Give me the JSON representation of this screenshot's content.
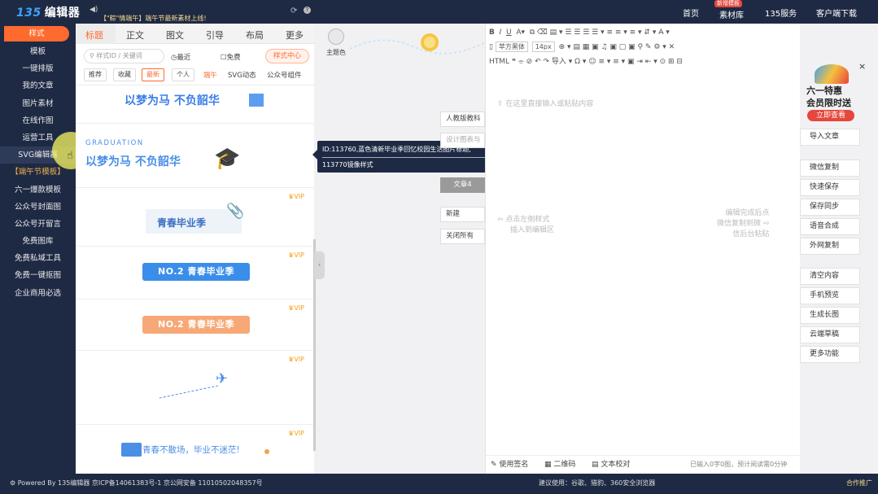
{
  "topbar": {
    "logo_mark": "135",
    "logo_text": "编辑器",
    "notice": "【\"粽\"情端午】端午节最新素材上线!",
    "nav": [
      "首页",
      "素材库",
      "135服务",
      "客户端下载"
    ],
    "badge": "新增模板"
  },
  "sidebar": {
    "items": [
      "样式",
      "模板",
      "一键排版",
      "我的文章",
      "图片素材",
      "在线作图",
      "运营工具",
      "SVG编辑器",
      "【端午节模板】",
      "六一爆款模板",
      "公众号封面图",
      "公众号开留言",
      "免费图库",
      "免费私域工具",
      "免费一键抠图",
      "企业商用必选"
    ],
    "active_index": 0
  },
  "template_panel": {
    "tabs": [
      "标题",
      "正文",
      "图文",
      "引导",
      "布局",
      "更多"
    ],
    "active_tab": 0,
    "search_placeholder": "样式ID / 关键词",
    "filters": [
      "最近",
      "免费"
    ],
    "style_center": "样式中心",
    "chips": [
      "推荐",
      "收藏",
      "最新",
      "个人"
    ],
    "active_chip": 2,
    "keywords": [
      "端午",
      "SVG动态",
      "公众号组件"
    ],
    "vip_label": "VIP",
    "templates": {
      "t1": "以梦为马 不负韶华",
      "t2_top": "GRADUATION",
      "t2_main": "以梦为马 不负韶华",
      "t3": "青春毕业季",
      "t4": "NO.2 青春毕业季",
      "t5": "NO.2 青春毕业季",
      "t7": "青春不散场，毕业不迷茫!"
    }
  },
  "theme_color": "主题色",
  "tooltip": {
    "line1": "ID:113760,蓝色清新毕业季回忆校园生活图片标题,",
    "line2": "113770镜像样式"
  },
  "side_buttons": [
    "人教版教科",
    "设计图表与",
    "文章4",
    "新建",
    "关闭所有"
  ],
  "editor": {
    "font_family": "苹方黑体",
    "font_size": "14px",
    "placeholder": "在这里直接输入或粘贴内容",
    "hint_left": [
      "点击左侧样式",
      "插入到编辑区"
    ],
    "hint_right": [
      "编辑完成后点",
      "微信复制到微",
      "信后台粘贴"
    ],
    "status": [
      "使用签名",
      "二维码",
      "文本校对"
    ],
    "word_count": "已输入0字0图，预计阅读需0分钟"
  },
  "right_panel": {
    "promo_title": "六一特惠",
    "promo_sub": "会员限时送",
    "promo_btn": "立即查看",
    "buttons": [
      "导入文章",
      "微信复制",
      "快速保存",
      "保存同步",
      "语音合成",
      "外网复制",
      "清空内容",
      "手机预览",
      "生成长图",
      "云端草稿",
      "更多功能"
    ]
  },
  "footer": {
    "left": "Powered By 135编辑器 京ICP备14061383号-1 京公网安备 11010502048357号",
    "mid": "建议使用：谷歌、猎豹、360安全浏览器",
    "right": "合作推广"
  }
}
